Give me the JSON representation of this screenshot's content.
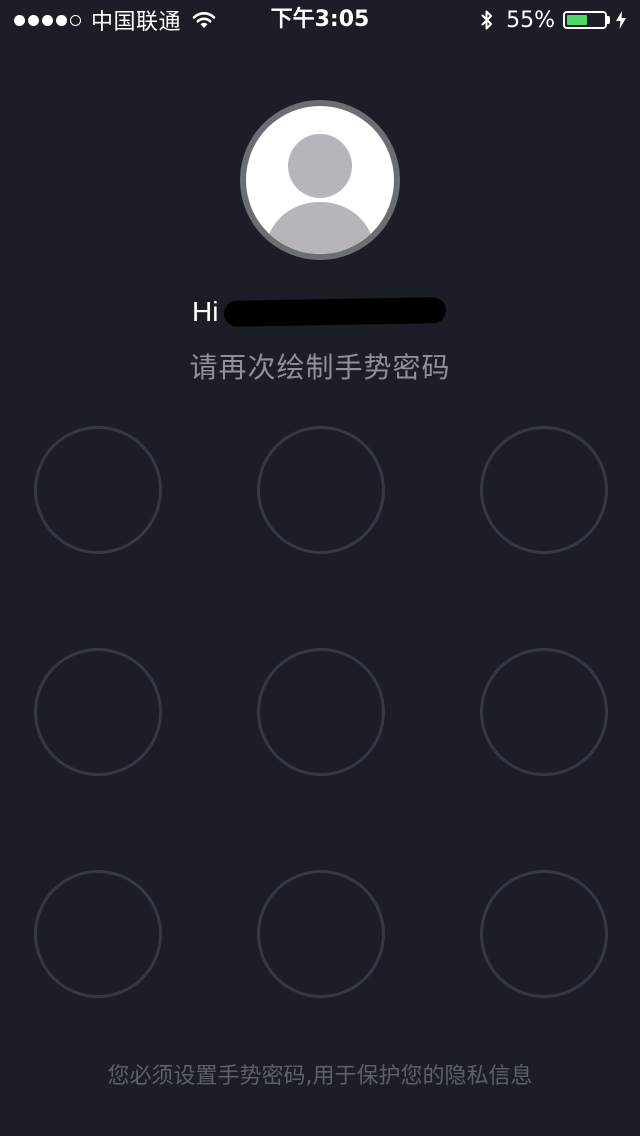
{
  "status_bar": {
    "carrier": "中国联通",
    "signal_bars": 4,
    "signal_max": 5,
    "time": "下午3:05",
    "battery_percent": "55%",
    "battery_level": 0.55,
    "icons": [
      "wifi-icon",
      "bluetooth-icon",
      "battery-icon",
      "charging-icon"
    ]
  },
  "avatar": {
    "icon": "user-placeholder-icon"
  },
  "greeting": {
    "hi": "Hi"
  },
  "prompt": "请再次绘制手势密码",
  "gesture_grid": {
    "rows": 3,
    "cols": 3
  },
  "footer": "您必须设置手势密码,用于保护您的隐私信息",
  "colors": {
    "background": "#1b1e26",
    "node_border": "#343944",
    "prompt_text": "#8e9198",
    "footer_text": "#5c6069",
    "battery_fill": "#4cd964"
  }
}
